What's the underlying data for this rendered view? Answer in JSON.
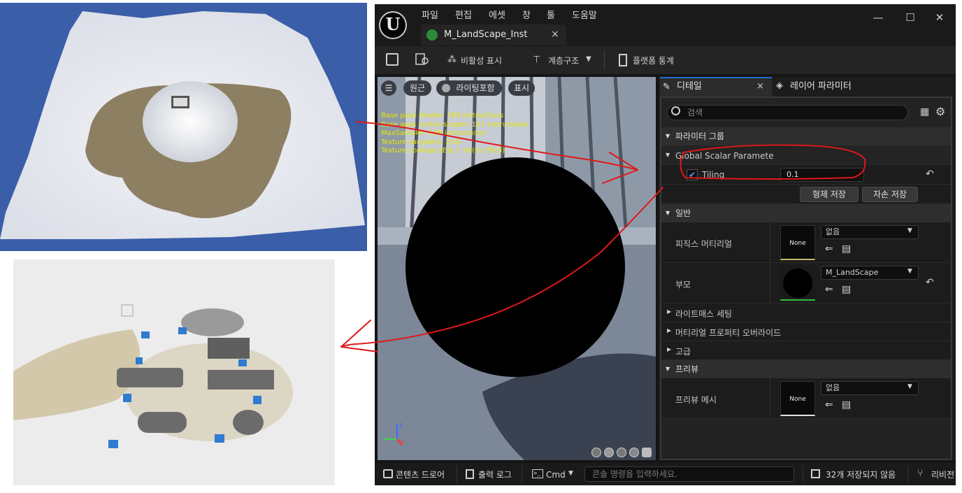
{
  "window": {
    "menu": [
      "파일",
      "편집",
      "에셋",
      "창",
      "툴",
      "도움말"
    ],
    "tab_title": "M_LandScape_Inst",
    "tab_close": "×",
    "min": "—",
    "max": "☐",
    "close": "✕"
  },
  "toolbar": {
    "hide_inactive": "비활성 표시",
    "hierarchy": "계층구조",
    "platform_stats": "플랫폼 통계"
  },
  "viewport": {
    "perspective": "원근",
    "lit": "라이팅포함",
    "show": "표시",
    "stats": [
      "Base pass shader: 185 instructions",
      "Base pass vertex shader: 131 instructions",
      "MaxSampler: 188 instructions",
      "Texture samplers: 2/16",
      "Texture Lookups (Est.): VS(0), PS(3)"
    ]
  },
  "details": {
    "tab_details": "디테일",
    "tab_layer": "레이어 파라미터",
    "tab_close": "×",
    "search_placeholder": "검색",
    "param_group": "파라미터 그룹",
    "global_scalar": "Global Scalar Paramete",
    "tiling_label": "Tiling",
    "tiling_value": "0.1",
    "save_sibling": "형제 저장",
    "save_child": "자손 저장",
    "general": "일반",
    "phys_material": "피직스 머티리얼",
    "phys_thumb": "None",
    "phys_value": "없음",
    "parent": "부모",
    "parent_value": "M_LandScape",
    "lightmass": "라이트매스 세팅",
    "mat_override": "머티리얼 프로퍼티 오버라이드",
    "advanced": "고급",
    "preview": "프리뷰",
    "preview_mesh": "프리뷰 메시",
    "preview_thumb": "None",
    "preview_value": "없음"
  },
  "statusbar": {
    "content_drawer": "콘텐츠 드로어",
    "output_log": "출력 로그",
    "cmd": "Cmd",
    "console_placeholder": "콘솔 명령을 입력하세요.",
    "unsaved": "32개 저장되지 않음",
    "revision": "리비전"
  },
  "colors": {
    "annotation": "#e01818",
    "accent_blue": "#1f6fd1",
    "ue_bg": "#151515",
    "panel_bg": "#232323"
  }
}
